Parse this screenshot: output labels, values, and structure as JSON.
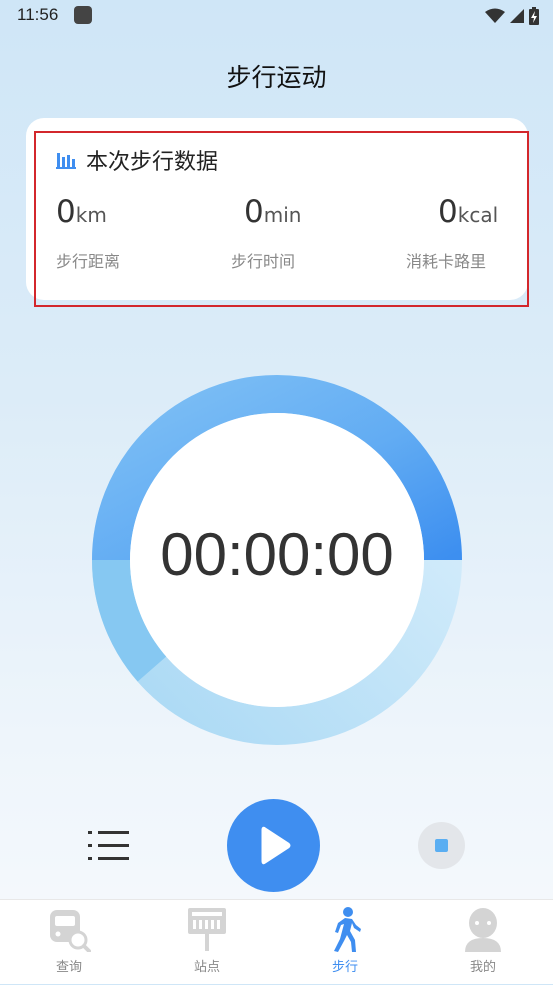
{
  "status": {
    "time": "11:56"
  },
  "header": {
    "title": "步行运动"
  },
  "card": {
    "title": "本次步行数据",
    "stats": [
      {
        "value": "0",
        "unit": "km",
        "label": "步行距离"
      },
      {
        "value": "0",
        "unit": "min",
        "label": "步行时间"
      },
      {
        "value": "0",
        "unit": "kcal",
        "label": "消耗卡路里"
      }
    ]
  },
  "timer": {
    "display": "00:00:00"
  },
  "controls": {
    "list_icon": "list-icon",
    "play_icon": "play-icon",
    "stop_icon": "stop-icon"
  },
  "nav": {
    "items": [
      {
        "label": "查询",
        "icon": "bus-search-icon",
        "active": false
      },
      {
        "label": "站点",
        "icon": "bus-stop-sign-icon",
        "active": false
      },
      {
        "label": "步行",
        "icon": "walking-person-icon",
        "active": true
      },
      {
        "label": "我的",
        "icon": "user-avatar-icon",
        "active": false
      }
    ]
  },
  "colors": {
    "accent": "#3f8ef0",
    "highlight_border": "#d3272c"
  }
}
